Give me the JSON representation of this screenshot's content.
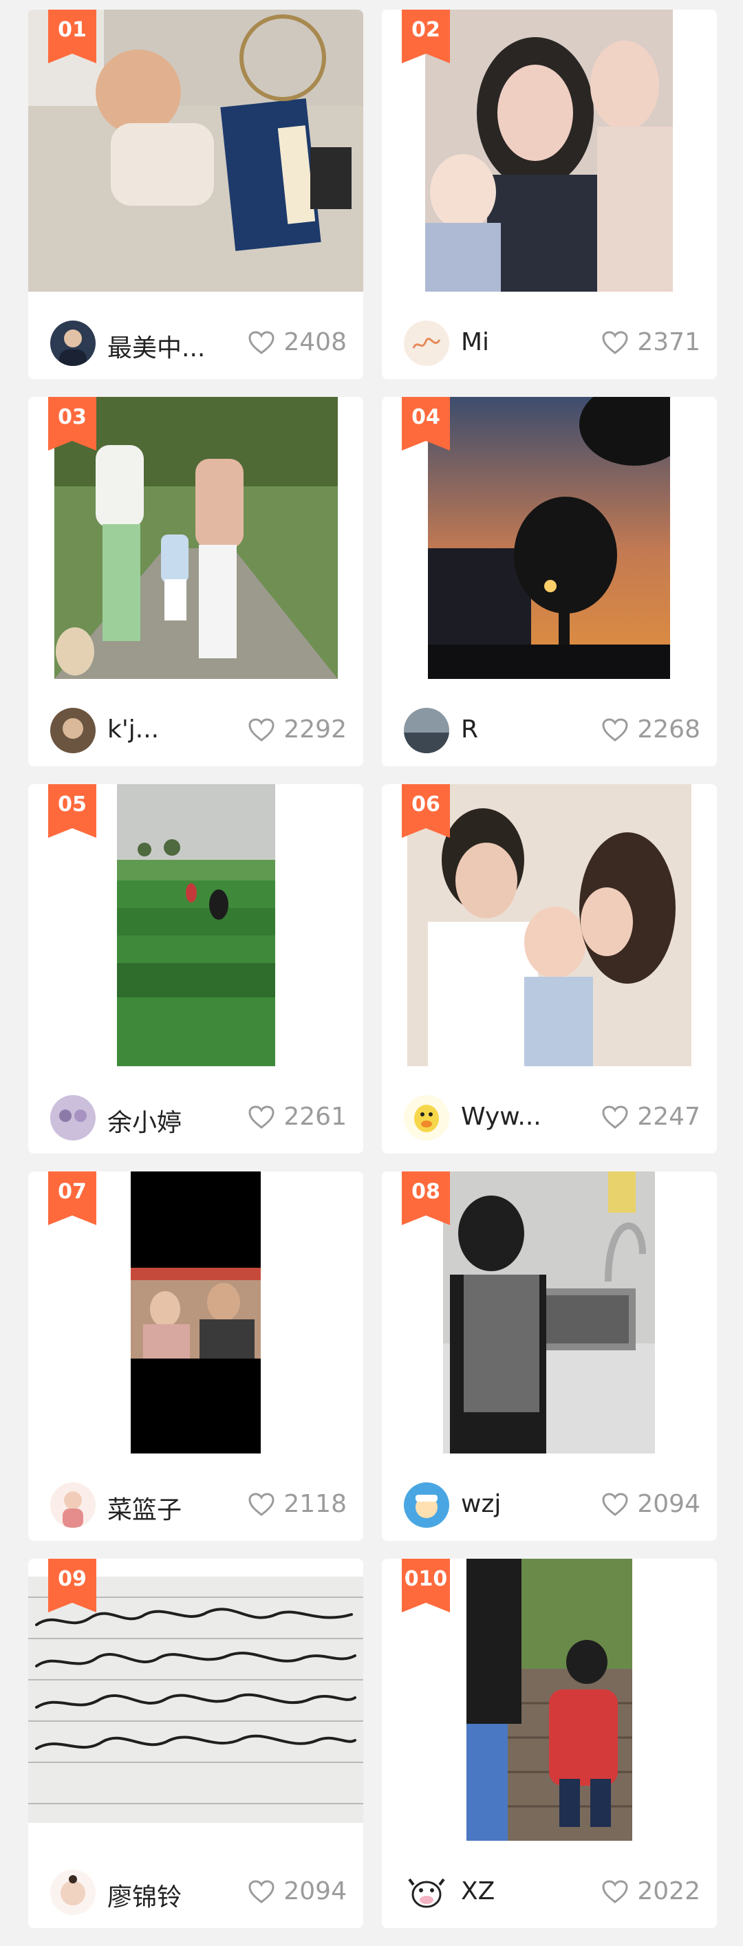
{
  "feed": {
    "items": [
      {
        "rank": "01",
        "author": "最美中...",
        "likes": "2408",
        "thumb_bg": "#c9c2b8",
        "accent": "#1d3a6b",
        "avatar_bg": "#2c3a52",
        "avatar_icon": "person-avatar-icon"
      },
      {
        "rank": "02",
        "author": "Mi",
        "likes": "2371",
        "thumb_bg": "#d9c6c0",
        "accent": "#2a2f3b",
        "avatar_bg": "#f7ece2",
        "avatar_icon": "calligraphy-avatar-icon"
      },
      {
        "rank": "03",
        "author": "k'j...",
        "likes": "2292",
        "thumb_bg": "#6b8d4f",
        "accent": "#e8e2dc",
        "avatar_bg": "#6b5540",
        "avatar_icon": "person-avatar-icon"
      },
      {
        "rank": "04",
        "author": "R",
        "likes": "2268",
        "thumb_bg": "#2f3f5c",
        "accent": "#ff7a2a",
        "avatar_bg": "#5f6d78",
        "avatar_icon": "landscape-avatar-icon"
      },
      {
        "rank": "05",
        "author": "余小婷",
        "likes": "2261",
        "thumb_bg": "#3f8a3a",
        "accent": "#c9cbc9",
        "avatar_bg": "#b8a6c9",
        "avatar_icon": "group-avatar-icon"
      },
      {
        "rank": "06",
        "author": "Wyw...",
        "likes": "2247",
        "thumb_bg": "#f0e3d8",
        "accent": "#3a2a22",
        "avatar_bg": "#fff7c8",
        "avatar_icon": "cartoon-duck-avatar-icon"
      },
      {
        "rank": "07",
        "author": "菜篮子",
        "likes": "2118",
        "thumb_bg": "#000000",
        "accent": "#c9a08a",
        "avatar_bg": "#f1d7d0",
        "avatar_icon": "child-avatar-icon"
      },
      {
        "rank": "08",
        "author": "wzj",
        "likes": "2094",
        "thumb_bg": "#b7b7b5",
        "accent": "#1e1e1e",
        "avatar_bg": "#4aa6e3",
        "avatar_icon": "cartoon-avatar-icon"
      },
      {
        "rank": "09",
        "author": "廖锦铃",
        "likes": "2094",
        "thumb_bg": "#e7e7e5",
        "accent": "#222222",
        "avatar_bg": "#f4e2d9",
        "avatar_icon": "baby-avatar-icon"
      },
      {
        "rank": "010",
        "author": "XZ",
        "likes": "2022",
        "thumb_bg": "#7a6a5c",
        "accent": "#d43a3a",
        "avatar_bg": "#ffffff",
        "avatar_icon": "cow-avatar-icon"
      }
    ]
  }
}
